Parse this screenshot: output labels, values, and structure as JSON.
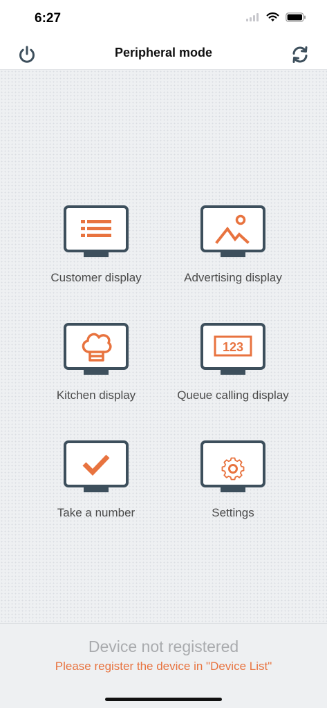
{
  "status_bar": {
    "time": "6:27",
    "icons": [
      "signal-icon",
      "wifi-icon",
      "battery-icon"
    ]
  },
  "nav": {
    "title": "Peripheral mode",
    "left_icon": "power-icon",
    "right_icon": "sync-icon"
  },
  "colors": {
    "accent": "#e8733f",
    "monitor": "#3d4f5c",
    "background": "#eef0f2"
  },
  "tiles": [
    {
      "label": "Customer display",
      "icon": "list-icon"
    },
    {
      "label": "Advertising display",
      "icon": "image-icon"
    },
    {
      "label": "Kitchen display",
      "icon": "chef-hat-icon"
    },
    {
      "label": "Queue calling display",
      "icon": "queue-number-icon",
      "number": "123"
    },
    {
      "label": "Take a number",
      "icon": "check-icon"
    },
    {
      "label": "Settings",
      "icon": "gear-icon"
    }
  ],
  "footer": {
    "title": "Device not registered",
    "hint": "Please register the device in \"Device List\""
  }
}
